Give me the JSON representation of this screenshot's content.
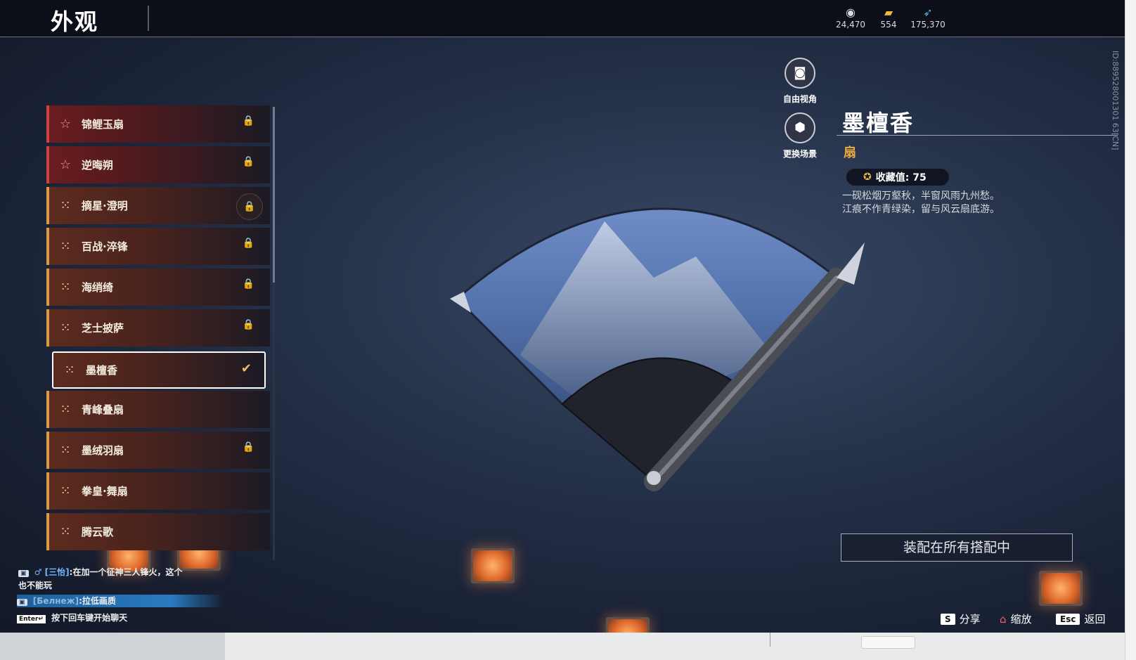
{
  "header": {
    "title": "外观",
    "currencies": [
      {
        "icon": "coin-icon",
        "value": "24,470"
      },
      {
        "icon": "ticket-icon",
        "value": "554"
      },
      {
        "icon": "feather-icon",
        "value": "175,370"
      }
    ]
  },
  "fan_list": {
    "items": [
      {
        "label": "锦鲤玉扇",
        "rarity": "red",
        "locked": true
      },
      {
        "label": "逆晦朔",
        "rarity": "red",
        "locked": true
      },
      {
        "label": "摘星·澄明",
        "rarity": "gold",
        "locked": true
      },
      {
        "label": "百战·淬锋",
        "rarity": "gold",
        "locked": true
      },
      {
        "label": "海绡绮",
        "rarity": "gold",
        "locked": true
      },
      {
        "label": "芝士披萨",
        "rarity": "gold",
        "locked": true
      },
      {
        "label": "墨檀香",
        "rarity": "gold",
        "locked": false,
        "selected": true
      },
      {
        "label": "青峰叠扇",
        "rarity": "gold",
        "locked": false
      },
      {
        "label": "墨绒羽扇",
        "rarity": "gold",
        "locked": true
      },
      {
        "label": "拳皇·舞扇",
        "rarity": "gold",
        "locked": false
      },
      {
        "label": "腾云歌",
        "rarity": "gold",
        "locked": false
      }
    ]
  },
  "controls": {
    "free_camera": "自由视角",
    "change_scene": "更换场景"
  },
  "detail": {
    "name": "墨檀香",
    "type": "扇",
    "collection_label": "收藏值: 75",
    "description_lines": [
      "一砚松烟万壑秋，半窗风雨九州愁。",
      "江痕不作青绿染，留与风云扇底游。"
    ],
    "player_id": "ID:889528001301 63[CN]",
    "equip_button": "装配在所有搭配中"
  },
  "hints": {
    "share_key": "S",
    "share": "分享",
    "zoom": "缩放",
    "back_key": "Esc",
    "back": "返回"
  },
  "chat": {
    "line1_name": "[三怡]",
    "line1_text": ":在加一个征神三人锋火，这个",
    "line1_cont": "也不能玩",
    "line2_name": "[Белнеж]",
    "line2_text": ":拉低画质",
    "enter_key": "Enter↵",
    "enter_hint": "按下回车键开始聊天"
  },
  "colors": {
    "accent_gold": "#e9a93e",
    "rarity_red": "#d1403f",
    "rarity_gold": "#d99a45"
  }
}
